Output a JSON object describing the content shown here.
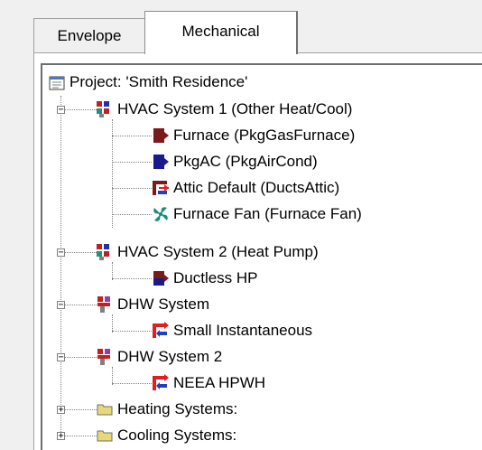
{
  "tabs": [
    {
      "label": "Envelope",
      "active": false
    },
    {
      "label": "Mechanical",
      "active": true
    }
  ],
  "tree": {
    "project": {
      "label": "Project:  'Smith Residence'",
      "icon": "project-icon"
    },
    "hvac1": {
      "label": "HVAC System 1  (Other Heat/Cool)",
      "icon": "hvac-system-icon",
      "expander": "minus",
      "children": [
        {
          "label": "Furnace  (PkgGasFurnace)",
          "icon": "furnace-icon"
        },
        {
          "label": "PkgAC  (PkgAirCond)",
          "icon": "air-conditioner-icon"
        },
        {
          "label": "Attic Default  (DuctsAttic)",
          "icon": "duct-icon"
        },
        {
          "label": "Furnace Fan  (Furnace Fan)",
          "icon": "fan-icon"
        }
      ]
    },
    "hvac2": {
      "label": "HVAC System 2  (Heat Pump)",
      "icon": "hvac-system-icon",
      "expander": "minus",
      "children": [
        {
          "label": "Ductless HP",
          "icon": "heat-pump-icon"
        }
      ]
    },
    "dhw1": {
      "label": "DHW System",
      "icon": "dhw-system-icon",
      "expander": "minus",
      "children": [
        {
          "label": "Small Instantaneous",
          "icon": "water-heater-icon"
        }
      ]
    },
    "dhw2": {
      "label": "DHW System 2",
      "icon": "dhw-system-icon",
      "expander": "minus",
      "children": [
        {
          "label": "NEEA HPWH",
          "icon": "water-heater-icon"
        }
      ]
    },
    "heating": {
      "label": "Heating Systems:",
      "icon": "folder-icon",
      "expander": "plus"
    },
    "cooling": {
      "label": "Cooling Systems:",
      "icon": "folder-icon",
      "expander": "plus"
    }
  },
  "colors": {
    "furnace": "#7a1a1a",
    "ac": "#1a1a8c",
    "fan": "#1a8c7a",
    "duct_red": "#e02020",
    "duct_blue": "#2040c0",
    "folder": "#e8d878"
  }
}
